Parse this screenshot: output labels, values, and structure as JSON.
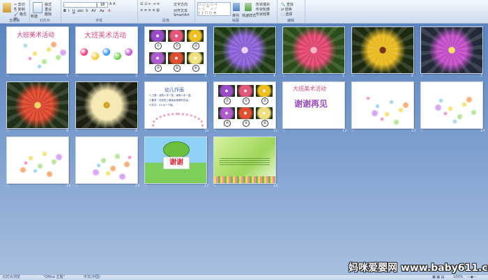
{
  "ribbon": {
    "groups": [
      "剪贴板",
      "幻灯片",
      "字体",
      "段落",
      "绘图",
      "编辑"
    ],
    "new_slide_label": "新建\n幻灯片",
    "font_size_value": "18",
    "buttons": [
      "粘贴",
      "版式",
      "重设",
      "删除",
      "排列",
      "快速样式",
      "形状填充",
      "形状轮廓",
      "形状效果",
      "查找",
      "替换",
      "选择"
    ]
  },
  "slides": [
    {
      "n": "1",
      "kind": "title-flowers",
      "title": "大班美术活动"
    },
    {
      "n": "2",
      "kind": "title-ornate",
      "title": "大班美术活动"
    },
    {
      "n": "3",
      "kind": "grid"
    },
    {
      "n": "4",
      "kind": "photo",
      "colors": [
        "#1e3a14",
        "#8a5fd6",
        "#e9d3ff"
      ]
    },
    {
      "n": "5",
      "kind": "photo",
      "colors": [
        "#2a4d1a",
        "#e0446c",
        "#f6b4c6"
      ]
    },
    {
      "n": "6",
      "kind": "photo",
      "colors": [
        "#1c2a10",
        "#e8b81f",
        "#6b2c10"
      ]
    },
    {
      "n": "7",
      "kind": "photo",
      "colors": [
        "#222a3a",
        "#c04cc6",
        "#f3e060"
      ]
    },
    {
      "n": "8",
      "kind": "photo",
      "colors": [
        "#203018",
        "#d9442a",
        "#f8d060"
      ]
    },
    {
      "n": "9",
      "kind": "photo",
      "colors": [
        "#1a1f10",
        "#f5e8b0",
        "#d4a020"
      ]
    },
    {
      "n": "10",
      "kind": "text",
      "title": "幼儿作画",
      "lines": [
        "1.工具：油笔人手一张，画笔人手一盒。",
        "2.要求：在纸的上面画出美丽的花朵。",
        "3.形式：4人为一个组。"
      ]
    },
    {
      "n": "11",
      "kind": "grid"
    },
    {
      "n": "12",
      "kind": "thanks",
      "title": "大班美术活动",
      "big": "谢谢再见"
    },
    {
      "n": "13",
      "kind": "flowers"
    },
    {
      "n": "14",
      "kind": "flowers"
    },
    {
      "n": "15",
      "kind": "flowers"
    },
    {
      "n": "16",
      "kind": "flowers"
    },
    {
      "n": "17",
      "kind": "frog",
      "big": "谢谢"
    },
    {
      "n": "18",
      "kind": "green"
    }
  ],
  "grid_numbers": [
    "①",
    "②",
    "③",
    "④",
    "⑤",
    "⑥"
  ],
  "status": {
    "slide": "幻灯片浏览",
    "theme": "\"Office 主题\"",
    "lang": "中文(中国)",
    "zoom": "100%"
  },
  "watermark": "妈咪爱婴网 www.baby611.com"
}
